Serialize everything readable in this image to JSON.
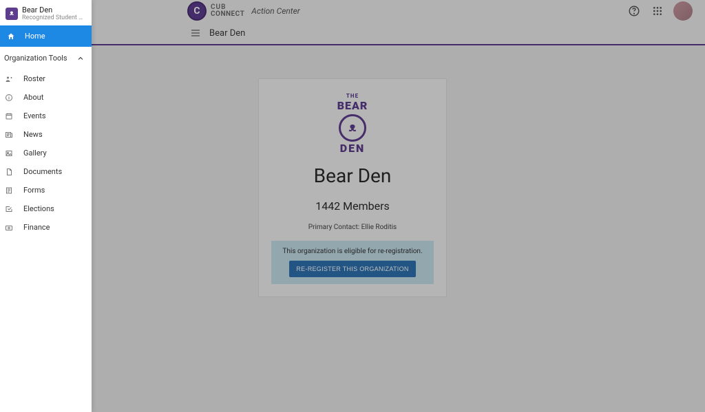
{
  "brand": {
    "logo_letter": "C",
    "line1": "CUB",
    "line2": "CONNECT",
    "sub": "Action Center"
  },
  "subheader": {
    "org_name": "Bear Den"
  },
  "card": {
    "logo_top": "THE",
    "logo_bear": "BEAR",
    "logo_face": "ᴥ",
    "logo_den": "DEN",
    "title": "Bear Den",
    "members": "1442 Members",
    "contact": "Primary Contact: Ellie Roditis",
    "notice": "This organization is eligible for re-registration.",
    "button": "RE-REGISTER THIS ORGANIZATION"
  },
  "sidebar": {
    "title": "Bear Den",
    "subtitle": "Recognized Student Orga...",
    "home": "Home",
    "section": "Organization Tools",
    "items": [
      {
        "label": "Roster"
      },
      {
        "label": "About"
      },
      {
        "label": "Events"
      },
      {
        "label": "News"
      },
      {
        "label": "Gallery"
      },
      {
        "label": "Documents"
      },
      {
        "label": "Forms"
      },
      {
        "label": "Elections"
      },
      {
        "label": "Finance"
      }
    ]
  }
}
